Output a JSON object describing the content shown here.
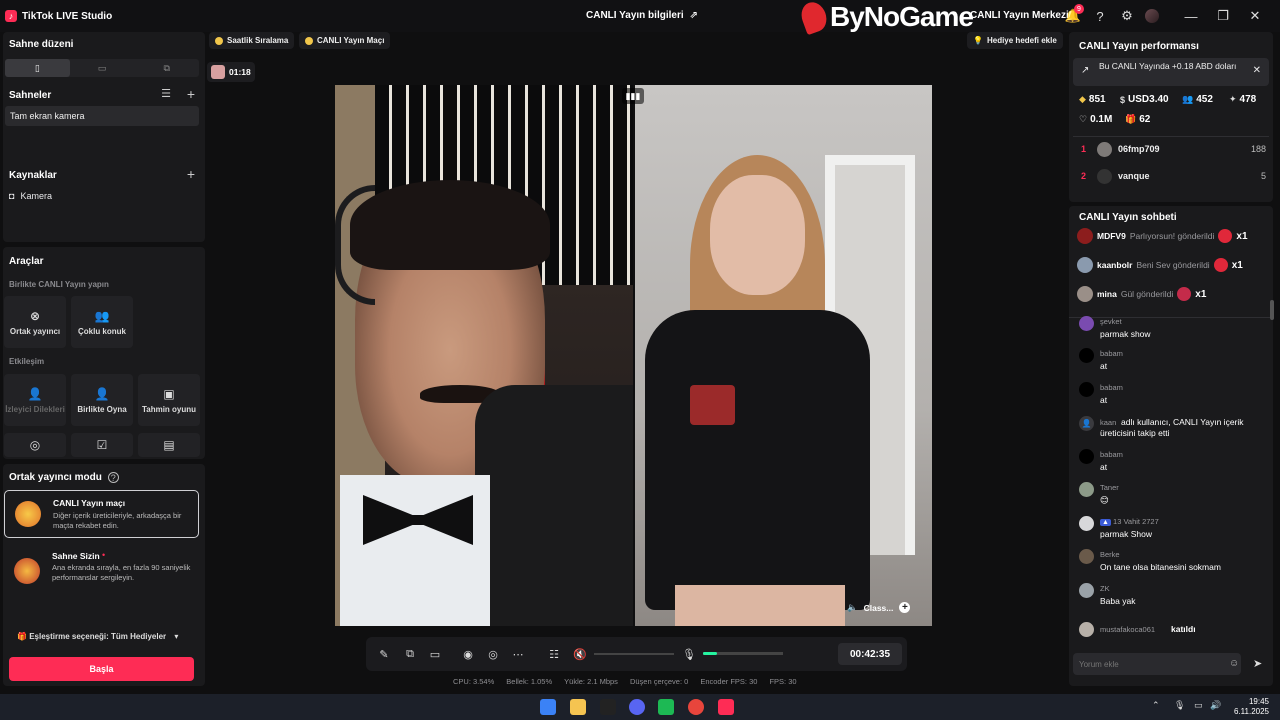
{
  "titlebar": {
    "app_name": "TikTok LIVE Studio",
    "center_title": "CANLI Yayın bilgileri",
    "watermark": "ByNoGame",
    "creator_center": "CANLI Yayın Merkezi",
    "notification_count": "9"
  },
  "left": {
    "scene_layout_title": "Sahne düzeni",
    "scenes_title": "Sahneler",
    "scene_item": "Tam ekran kamera",
    "sources_title": "Kaynaklar",
    "source_item": "Kamera",
    "tools_title": "Araçlar",
    "collab_sub": "Birlikte CANLI Yayın yapın",
    "cohost_card": "Ortak yayıncı",
    "multi_guest": "Çoklu konuk",
    "interaction_sub": "Etkileşim",
    "viewer_wishes": "İzleyici Dilekleri",
    "play_together": "Birlikte Oyna",
    "prediction": "Tahmin oyunu",
    "cohost_mode_title": "Ortak yayıncı modu",
    "match_title": "CANLI Yayın maçı",
    "match_desc": "Diğer içerik üreticileriyle, arkadaşça bir maçta rekabet edin.",
    "stage_title": "Sahne Sizin",
    "stage_desc": "Ana ekranda sırayla, en fazla 90 saniyelik performanslar sergileyin.",
    "match_pref": "Eşleştirme seçeneği: Tüm Hediyeler",
    "start_button": "Başla"
  },
  "topbar": {
    "hourly_rank": "Saatlik Sıralama",
    "live_match": "CANLI Yayın Maçı",
    "gift_goal": "Hediye hedefi ekle",
    "timer": "01:18"
  },
  "video": {
    "cohost_label": "Class..."
  },
  "controls": {
    "elapsed": "00:42:35",
    "mic_level": 0.18
  },
  "stats": {
    "cpu": "CPU: 3.54%",
    "memory": "Bellek: 1.05%",
    "upload": "Yükle: 2.1 Mbps",
    "dropped": "Düşen çerçeve: 0",
    "encoder_fps": "Encoder FPS: 30",
    "fps": "FPS: 30"
  },
  "perf": {
    "title": "CANLI Yayın performansı",
    "earning": "Bu CANLI Yayında +0.18 ABD doları",
    "diamonds": "851",
    "usd": "USD3.40",
    "viewers": "452",
    "gifters": "478",
    "likes": "0.1M",
    "gifts": "62",
    "ranking": [
      {
        "rank": "1",
        "name": "06fmp709",
        "score": "188"
      },
      {
        "rank": "2",
        "name": "vanque",
        "score": "5"
      }
    ]
  },
  "chat": {
    "title": "CANLI Yayın sohbeti",
    "gifts": [
      {
        "name": "MDFV9",
        "action": "Parlıyorsun! gönderildi",
        "count": "x1"
      },
      {
        "name": "kaanbolr",
        "action": "Beni Sev gönderildi",
        "count": "x1"
      },
      {
        "name": "mina",
        "action": "Gül gönderildi",
        "count": "x1"
      }
    ],
    "messages": [
      {
        "name": "şevket",
        "text": "parmak show"
      },
      {
        "name": "babam",
        "text": "at"
      },
      {
        "name": "babam",
        "text": "at"
      },
      {
        "name": "kaan",
        "text": "adlı kullanıcı, CANLI Yayın içerik üreticisini takip etti"
      },
      {
        "name": "babam",
        "text": "at"
      },
      {
        "name": "Taner",
        "text": "😊"
      },
      {
        "name": "13 Vahit 2727",
        "text": "parmak Show"
      },
      {
        "name": "Berke",
        "text": "On tane olsa bitanesini sokmam"
      },
      {
        "name": "ZK",
        "text": "Baba yak"
      },
      {
        "name": "mustafakoca061",
        "text": "katıldı"
      }
    ],
    "input_placeholder": "Yorum ekle"
  },
  "taskbar": {
    "time": "19:45",
    "date": "6.11.2025"
  }
}
